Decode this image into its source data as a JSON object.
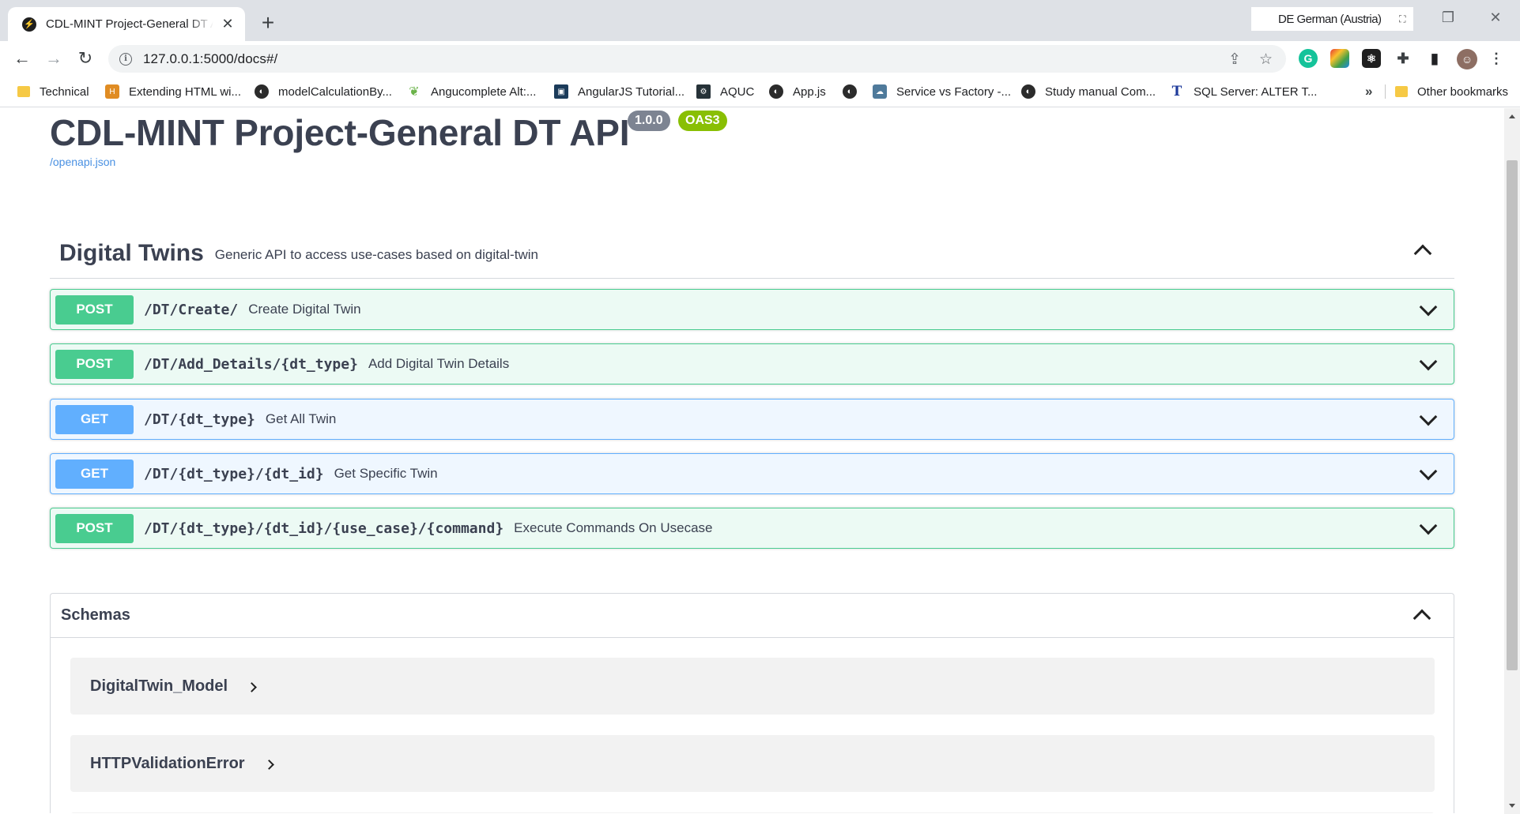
{
  "browser": {
    "tab_title": "CDL-MINT Project-General DT API",
    "tab_close": "✕",
    "new_tab": "+",
    "language": "DE German (Austria)",
    "url": "127.0.0.1:5000/docs#/",
    "bookmarks": [
      {
        "label": "Technical",
        "icon": "folder-icon"
      },
      {
        "label": "Extending HTML wi...",
        "icon": "bookmark-favicon"
      },
      {
        "label": "modelCalculationBy...",
        "icon": "globe-icon"
      },
      {
        "label": "Angucomplete Alt:...",
        "icon": "bookmark-favicon"
      },
      {
        "label": "AngularJS Tutorial...",
        "icon": "bookmark-favicon"
      },
      {
        "label": "AQUC",
        "icon": "bookmark-favicon"
      },
      {
        "label": "App.js",
        "icon": "globe-icon"
      },
      {
        "label": "",
        "icon": "globe-icon"
      },
      {
        "label": "Service vs Factory -...",
        "icon": "bookmark-favicon"
      },
      {
        "label": "Study manual Com...",
        "icon": "globe-icon"
      },
      {
        "label": "SQL Server: ALTER T...",
        "icon": "bookmark-favicon"
      }
    ],
    "bookmarks_more": "»",
    "other_bookmarks": "Other bookmarks"
  },
  "api": {
    "title": "CDL-MINT Project-General DT API",
    "version": "1.0.0",
    "spec_badge": "OAS3",
    "spec_link": "/openapi.json"
  },
  "tag": {
    "name": "Digital Twins",
    "description": "Generic API to access use-cases based on digital-twin"
  },
  "operations": [
    {
      "method": "POST",
      "path": "/DT/Create/",
      "summary": "Create Digital Twin"
    },
    {
      "method": "POST",
      "path": "/DT/Add_Details/{dt_type}",
      "summary": "Add Digital Twin Details"
    },
    {
      "method": "GET",
      "path": "/DT/{dt_type}",
      "summary": "Get All Twin"
    },
    {
      "method": "GET",
      "path": "/DT/{dt_type}/{dt_id}",
      "summary": "Get Specific Twin"
    },
    {
      "method": "POST",
      "path": "/DT/{dt_type}/{dt_id}/{use_case}/{command}",
      "summary": "Execute Commands On Usecase"
    }
  ],
  "schemas": {
    "title": "Schemas",
    "models": [
      "DigitalTwin_Model",
      "HTTPValidationError"
    ]
  },
  "colors": {
    "post": "#49cc90",
    "get": "#61affe",
    "version_badge": "#7d8492",
    "oas_badge": "#89bf04",
    "link": "#4990e2"
  }
}
